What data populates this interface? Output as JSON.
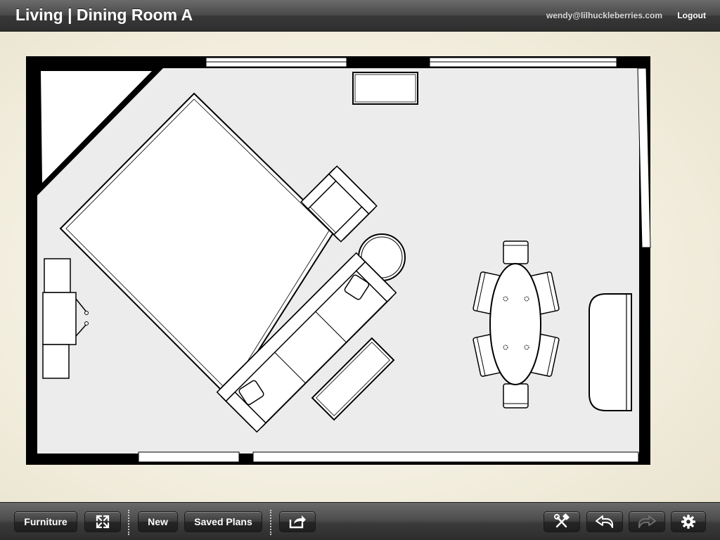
{
  "header": {
    "title": "Living | Dining Room A",
    "user_email": "wendy@lilhuckleberries.com",
    "logout_label": "Logout"
  },
  "toolbar": {
    "furniture_label": "Furniture",
    "fullscreen_icon": "expand-icon",
    "new_label": "New",
    "saved_plans_label": "Saved Plans",
    "share_icon": "share-icon",
    "tools_icon": "hammer-wrench-icon",
    "undo_icon": "undo-arrow-icon",
    "redo_icon": "redo-arrow-icon",
    "settings_icon": "gear-icon"
  },
  "floor_plan": {
    "furniture": [
      "rug",
      "sofa",
      "armchair",
      "round-side-table",
      "coffee-table",
      "media-console",
      "console-desk",
      "dining-table",
      "dining-chair",
      "bench-sofa"
    ]
  },
  "colors": {
    "wall": "#000000",
    "floor": "#ececec",
    "furniture_fill": "#ffffff",
    "toolbar_dark": "#2e2e2e"
  }
}
